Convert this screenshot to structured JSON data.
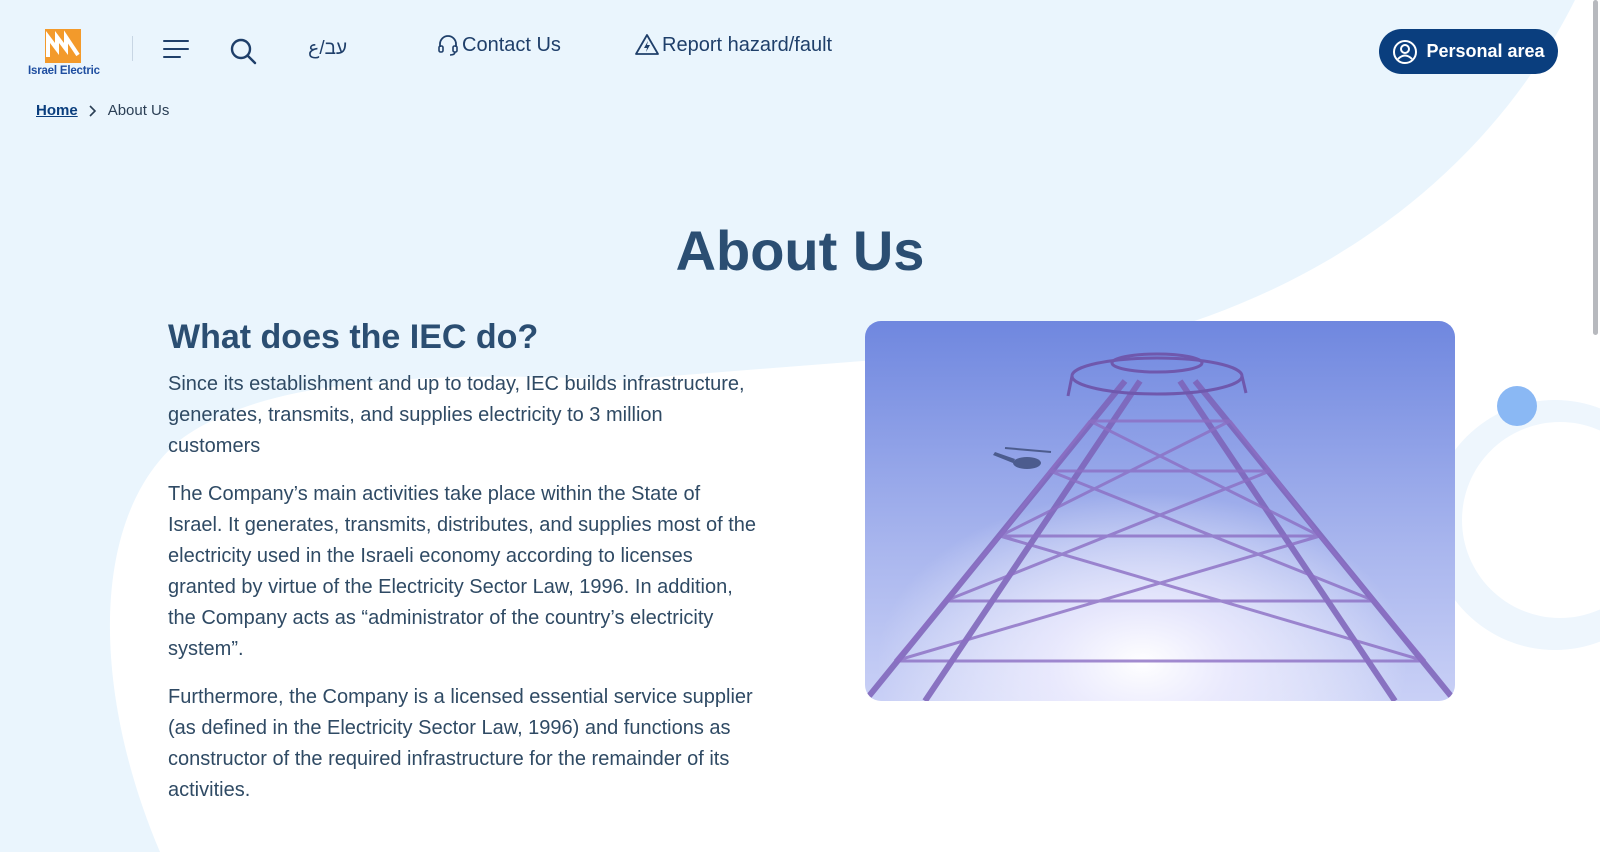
{
  "header": {
    "logo_text": "Israel Electric",
    "lang_label": "עב/ع",
    "contact_label": "Contact Us",
    "report_label": "Report hazard/fault",
    "personal_area_label": "Personal area"
  },
  "breadcrumb": {
    "home": "Home",
    "current": "About Us"
  },
  "page": {
    "title": "About Us",
    "section_heading": "What does the IEC do?",
    "paragraphs": [
      "Since its establishment and up to today, IEC builds infrastructure, generates, transmits, and supplies electricity to 3 million customers",
      "The Company’s main activities take place within the State of Israel. It generates, transmits, distributes, and supplies most of the electricity used in the Israeli economy according to licenses granted by virtue of the Electricity Sector Law, 1996. In addition, the Company acts as “administrator of the country’s electricity system”.",
      "Furthermore, the Company is a licensed essential service supplier (as defined in the Electricity Sector Law, 1996) and functions as constructor of the required infrastructure for the remainder of its activities."
    ]
  },
  "colors": {
    "background": "#eaf5fd",
    "accent_dark_blue": "#0a3e7e",
    "heading": "#2b4e72",
    "logo_orange": "#f39a2b"
  },
  "icons": {
    "menu": "hamburger-icon",
    "search": "search-icon",
    "contact": "headset-icon",
    "report": "warning-icon",
    "personal": "user-circle-icon",
    "breadcrumb_separator": "chevron-right-icon"
  }
}
